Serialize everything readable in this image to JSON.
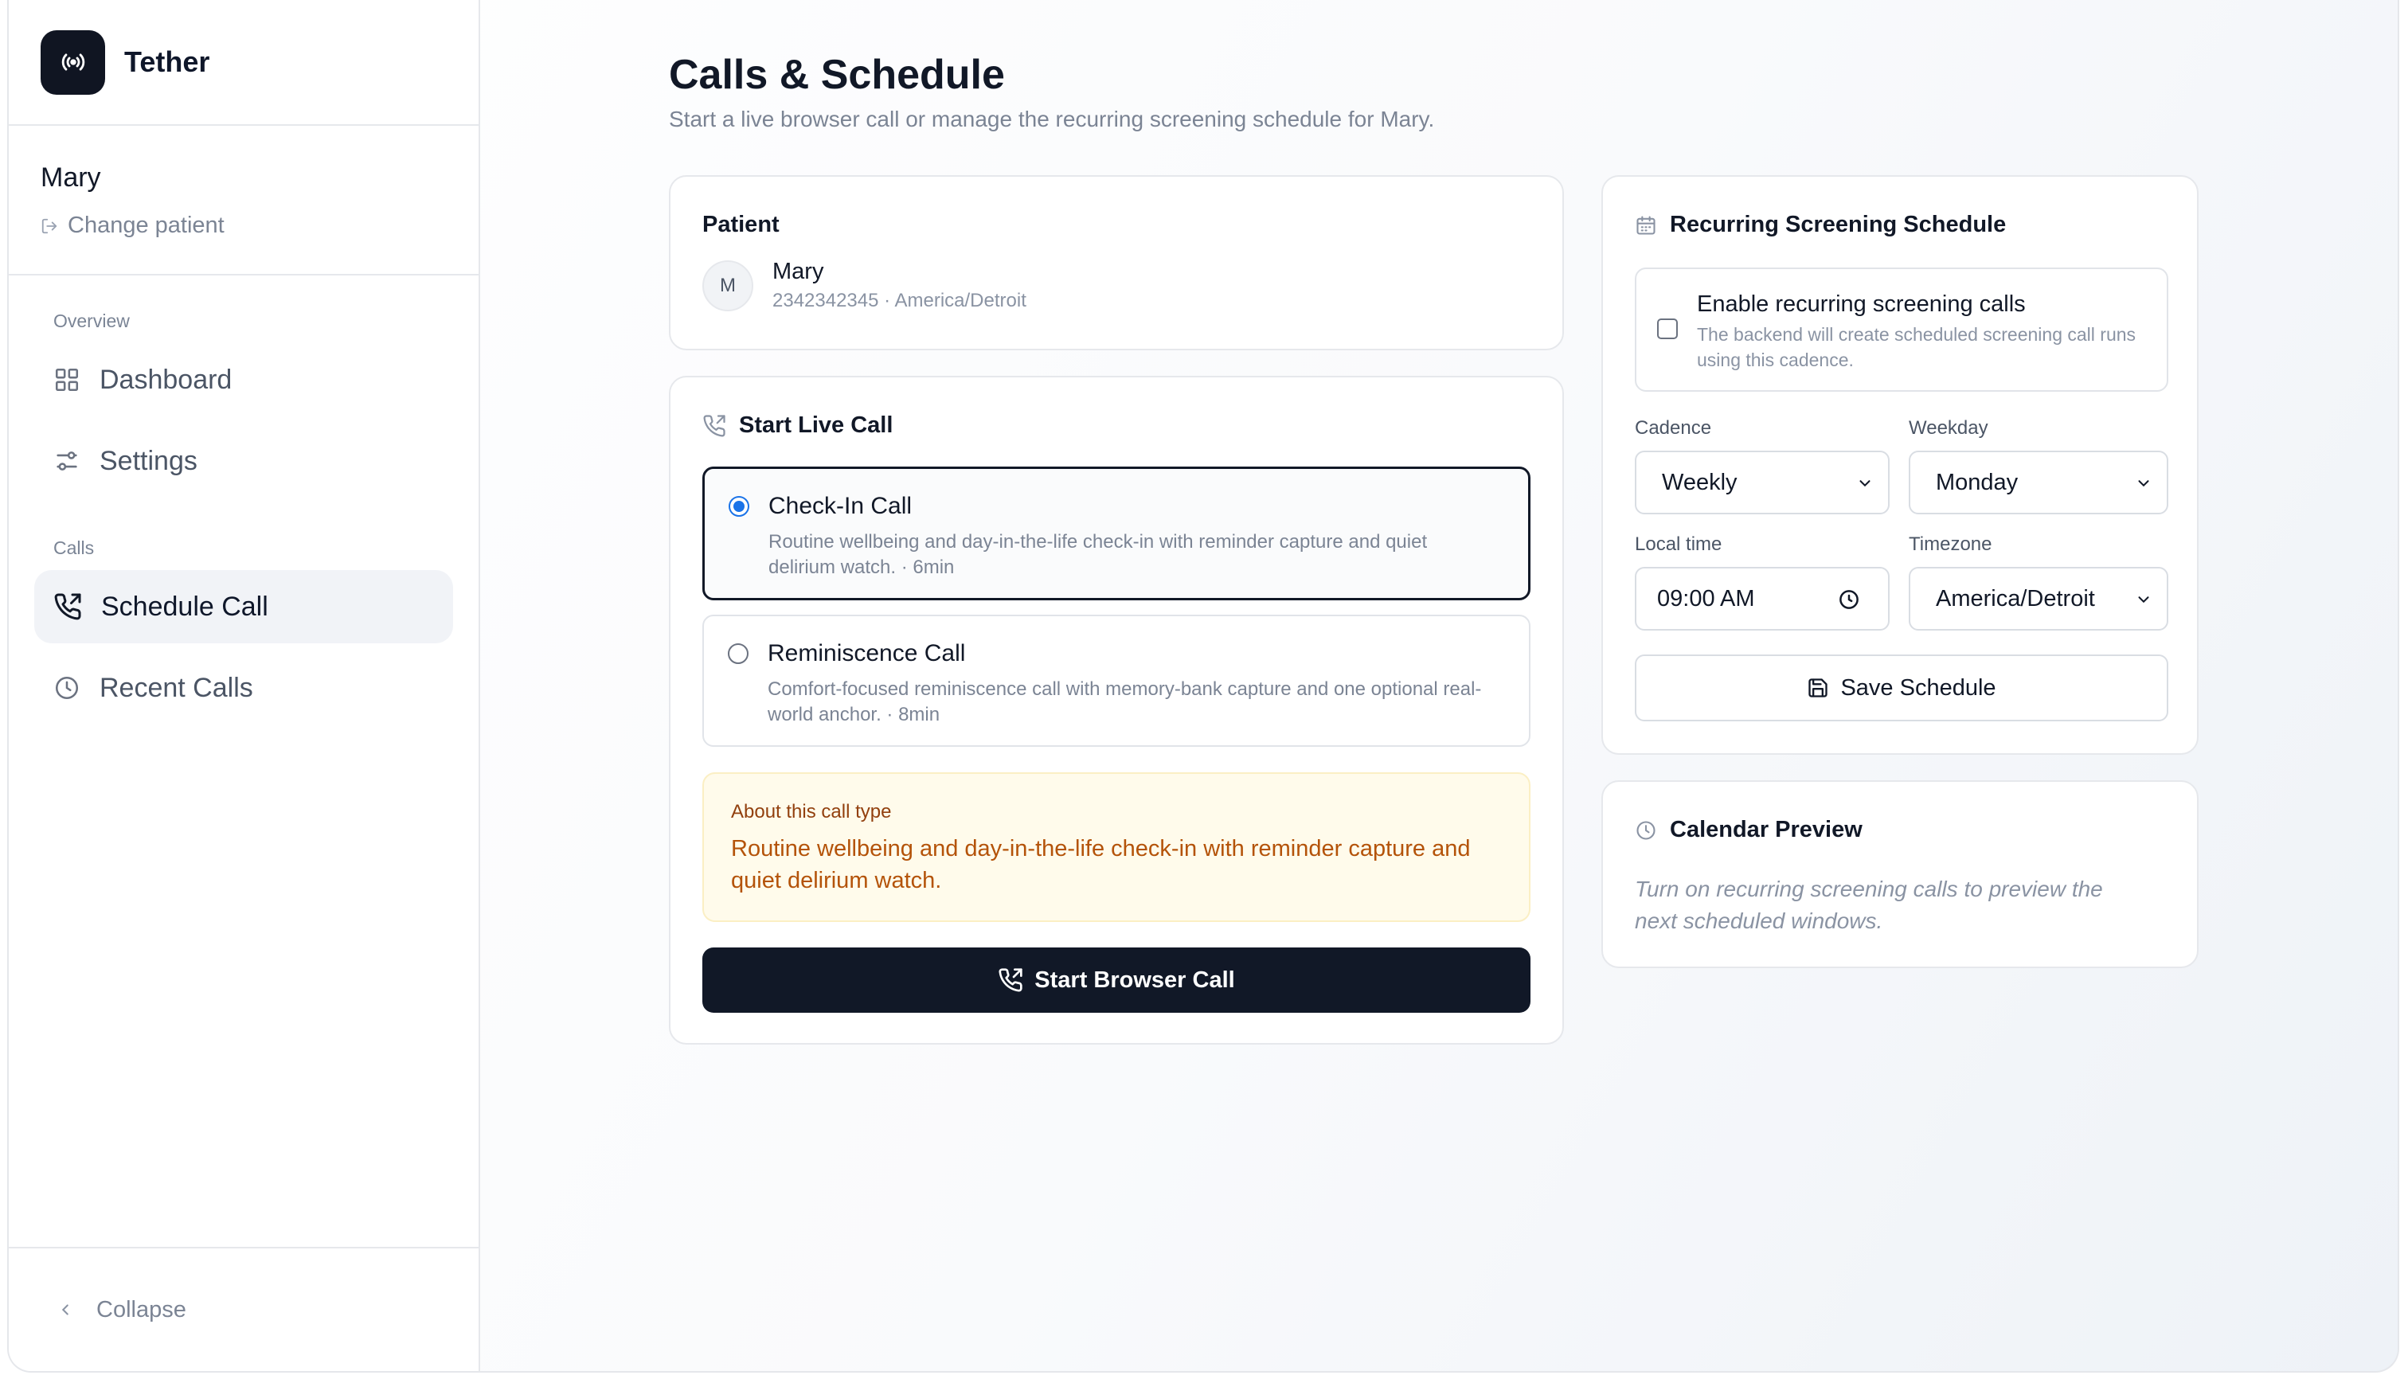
{
  "app": {
    "name": "Tether"
  },
  "sidebar": {
    "patient_name": "Mary",
    "change_patient": "Change patient",
    "overview_heading": "Overview",
    "overview_items": [
      {
        "label": "Dashboard",
        "icon": "grid-icon"
      },
      {
        "label": "Settings",
        "icon": "sliders-icon"
      }
    ],
    "calls_heading": "Calls",
    "calls_items": [
      {
        "label": "Schedule Call",
        "icon": "phone-outgoing-icon",
        "active": true
      },
      {
        "label": "Recent Calls",
        "icon": "clock-icon",
        "active": false
      }
    ],
    "collapse": "Collapse"
  },
  "page": {
    "title": "Calls & Schedule",
    "subtitle": "Start a live browser call or manage the recurring screening schedule for Mary."
  },
  "patient_card": {
    "title": "Patient",
    "avatar_initial": "M",
    "name": "Mary",
    "meta": "2342342345 · America/Detroit"
  },
  "live_call": {
    "title": "Start Live Call",
    "options": [
      {
        "title": "Check-In Call",
        "description": "Routine wellbeing and day-in-the-life check-in with reminder capture and quiet delirium watch. · 6min",
        "selected": true
      },
      {
        "title": "Reminiscence Call",
        "description": "Comfort-focused reminiscence call with memory-bank capture and one optional real-world anchor. · 8min",
        "selected": false
      }
    ],
    "about_label": "About this call type",
    "about_text": "Routine wellbeing and day-in-the-life check-in with reminder capture and quiet delirium watch.",
    "start_button": "Start Browser Call"
  },
  "schedule": {
    "title": "Recurring Screening Schedule",
    "enable_title": "Enable recurring screening calls",
    "enable_desc": "The backend will create scheduled screening call runs using this cadence.",
    "enabled": false,
    "cadence_label": "Cadence",
    "cadence_value": "Weekly",
    "weekday_label": "Weekday",
    "weekday_value": "Monday",
    "local_time_label": "Local time",
    "local_time_value": "09:00 AM",
    "timezone_label": "Timezone",
    "timezone_value": "America/Detroit",
    "save_button": "Save Schedule"
  },
  "preview": {
    "title": "Calendar Preview",
    "text": "Turn on recurring screening calls to preview the next scheduled windows."
  },
  "colors": {
    "primary_dark": "#111827",
    "radio_accent": "#1a73e8",
    "about_bg": "#fffbeb",
    "about_text": "#b45309"
  }
}
